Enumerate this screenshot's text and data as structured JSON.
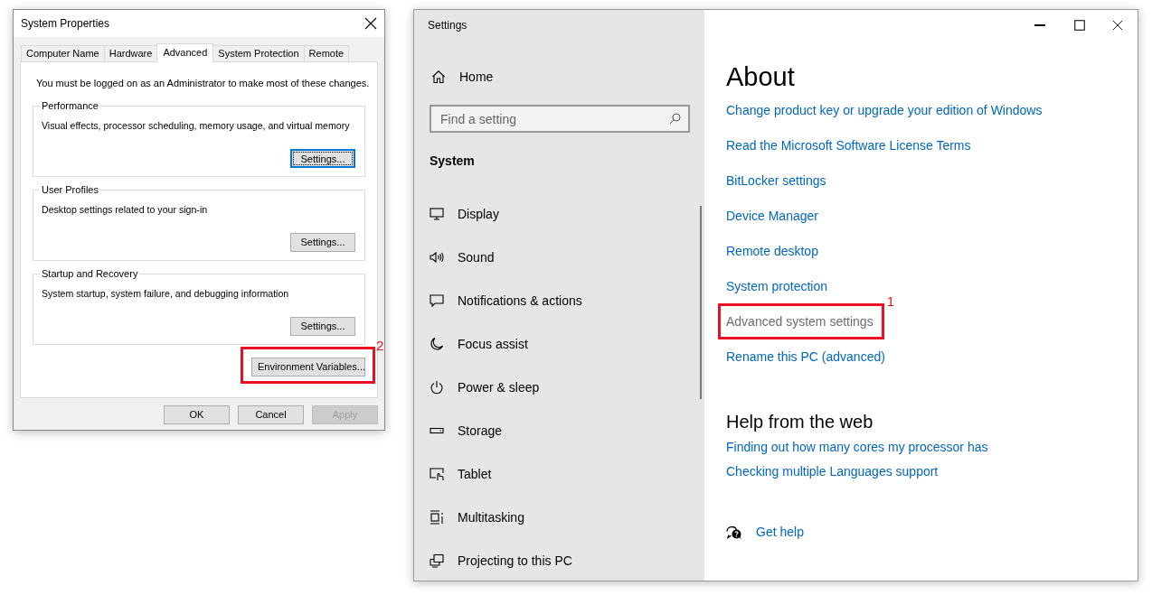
{
  "system_properties": {
    "title": "System Properties",
    "tabs": [
      {
        "label": "Computer Name",
        "selected": false
      },
      {
        "label": "Hardware",
        "selected": false
      },
      {
        "label": "Advanced",
        "selected": true
      },
      {
        "label": "System Protection",
        "selected": false
      },
      {
        "label": "Remote",
        "selected": false
      }
    ],
    "notice": "You must be logged on as an Administrator to make most of these changes.",
    "groups": [
      {
        "legend": "Performance",
        "description": "Visual effects, processor scheduling, memory usage, and virtual memory",
        "button": {
          "label": "Settings...",
          "focused": true
        }
      },
      {
        "legend": "User Profiles",
        "description": "Desktop settings related to your sign-in",
        "button": {
          "label": "Settings...",
          "focused": false
        }
      },
      {
        "legend": "Startup and Recovery",
        "description": "System startup, system failure, and debugging information",
        "button": {
          "label": "Settings...",
          "focused": false
        }
      }
    ],
    "environment_button": {
      "label": "Environment Variables...",
      "annotation": "2"
    },
    "buttons": [
      {
        "label": "OK",
        "disabled": false
      },
      {
        "label": "Cancel",
        "disabled": false
      },
      {
        "label": "Apply",
        "disabled": true
      }
    ]
  },
  "settings": {
    "title": "Settings",
    "home": "Home",
    "search": {
      "placeholder": "Find a setting"
    },
    "section": "System",
    "nav_items": [
      {
        "label": "Display"
      },
      {
        "label": "Sound"
      },
      {
        "label": "Notifications & actions"
      },
      {
        "label": "Focus assist"
      },
      {
        "label": "Power & sleep"
      },
      {
        "label": "Storage"
      },
      {
        "label": "Tablet"
      },
      {
        "label": "Multitasking"
      },
      {
        "label": "Projecting to this PC"
      }
    ],
    "page_title": "About",
    "links": [
      {
        "label": "Change product key or upgrade your edition of Windows",
        "muted": false
      },
      {
        "label": "Read the Microsoft Software License Terms",
        "muted": false
      },
      {
        "label": "BitLocker settings",
        "muted": false
      },
      {
        "label": "Device Manager",
        "muted": false
      },
      {
        "label": "Remote desktop",
        "muted": false
      },
      {
        "label": "System protection",
        "muted": false
      },
      {
        "label": "Advanced system settings",
        "muted": true,
        "annotation": "1"
      },
      {
        "label": "Rename this PC (advanced)",
        "muted": false
      }
    ],
    "help_title": "Help from the web",
    "help_links": [
      {
        "label": "Finding out how many cores my processor has"
      },
      {
        "label": "Checking multiple Languages support"
      }
    ],
    "get_help": "Get help"
  }
}
